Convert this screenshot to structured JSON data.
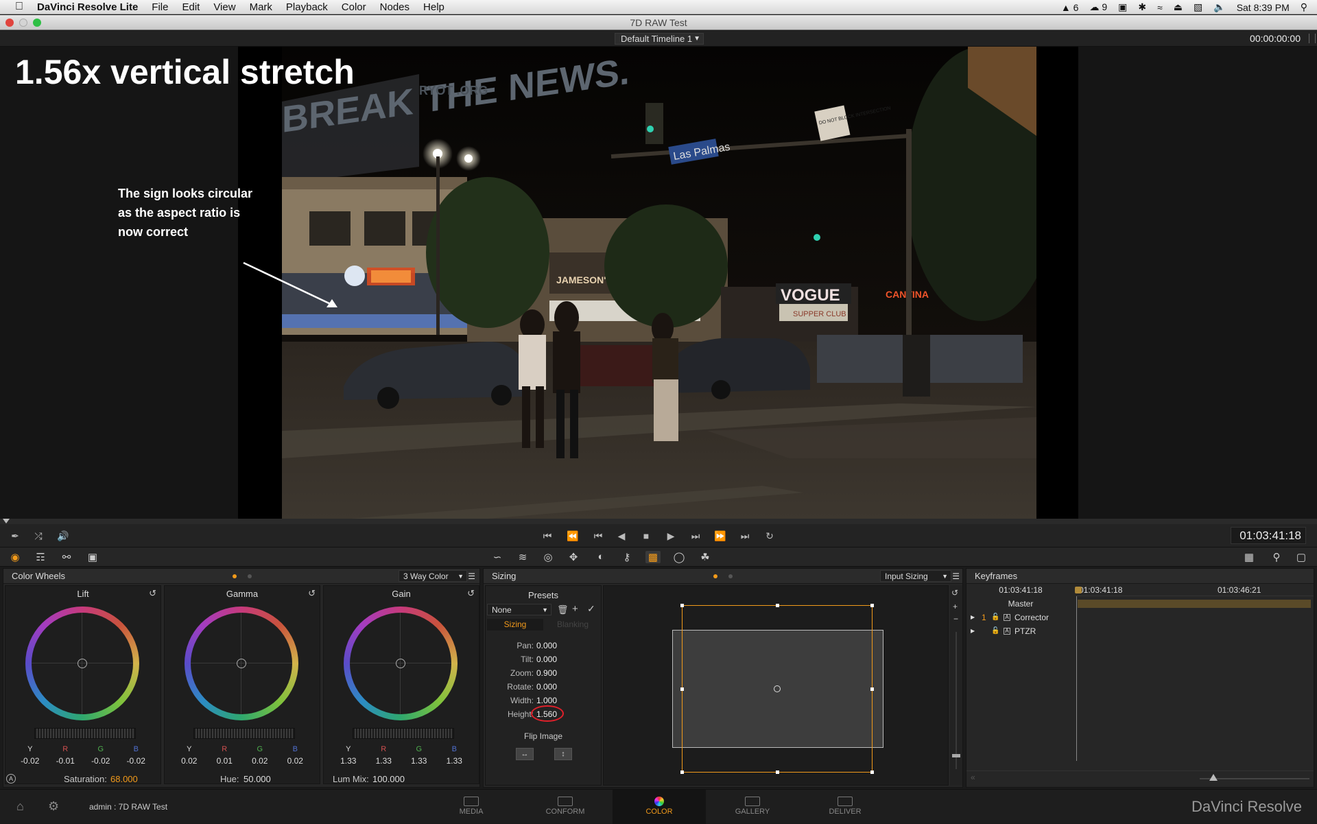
{
  "menubar": {
    "app_name": "DaVinci Resolve Lite",
    "items": [
      "File",
      "Edit",
      "View",
      "Mark",
      "Playback",
      "Color",
      "Nodes",
      "Help"
    ],
    "status": {
      "adobe": "6",
      "cc": "9",
      "clock": "Sat 8:39 PM"
    }
  },
  "window": {
    "title": "7D RAW Test"
  },
  "viewer": {
    "timeline_select": "Default Timeline 1",
    "timecode_top": "00:00:00:00",
    "overlay_title": "1.56x vertical stretch",
    "annotation": [
      "The sign looks circular",
      "as the aspect ratio is",
      "now correct"
    ],
    "signs": {
      "billboard": "BREAK THE NEWS.",
      "ryot": "RYOT .ORG",
      "street": "Las Palmas",
      "donotblock": "DO NOT BLOCK INTERSECTION",
      "pub": "JAMESON'S IRISH PUB",
      "vogue": "VOGUE",
      "club": "SUPPER CLUB",
      "cantina": "CANTINA"
    }
  },
  "transport": {
    "timecode": "01:03:41:18"
  },
  "color_wheels": {
    "title": "Color Wheels",
    "mode": "3 Way Color",
    "wheels": [
      {
        "name": "Lift",
        "labels": [
          "Y",
          "R",
          "G",
          "B"
        ],
        "values": [
          "-0.02",
          "-0.01",
          "-0.02",
          "-0.02"
        ]
      },
      {
        "name": "Gamma",
        "labels": [
          "Y",
          "R",
          "G",
          "B"
        ],
        "values": [
          "0.02",
          "0.01",
          "0.02",
          "0.02"
        ]
      },
      {
        "name": "Gain",
        "labels": [
          "Y",
          "R",
          "G",
          "B"
        ],
        "values": [
          "1.33",
          "1.33",
          "1.33",
          "1.33"
        ]
      }
    ],
    "footer": {
      "saturation_label": "Saturation:",
      "saturation": "68.000",
      "hue_label": "Hue:",
      "hue": "50.000",
      "lummix_label": "Lum Mix:",
      "lummix": "100.000"
    }
  },
  "sizing": {
    "title": "Sizing",
    "mode": "Input Sizing",
    "presets_label": "Presets",
    "preset_value": "None",
    "tabs": [
      "Sizing",
      "Blanking"
    ],
    "params": [
      {
        "label": "Pan:",
        "value": "0.000"
      },
      {
        "label": "Tilt:",
        "value": "0.000"
      },
      {
        "label": "Zoom:",
        "value": "0.900"
      },
      {
        "label": "Rotate:",
        "value": "0.000"
      },
      {
        "label": "Width:",
        "value": "1.000"
      },
      {
        "label": "Height:",
        "value": "1.560"
      }
    ],
    "flip_label": "Flip Image"
  },
  "keyframes": {
    "title": "Keyframes",
    "tc_left": "01:03:41:18",
    "tc_ruler_1": "01:03:41:18",
    "tc_ruler_2": "01:03:46:21",
    "tracks": [
      {
        "name": "Master"
      },
      {
        "num": "1",
        "name": "Corrector"
      },
      {
        "name": "PTZR"
      }
    ]
  },
  "bottom": {
    "project": "admin : 7D RAW Test",
    "tabs": [
      "MEDIA",
      "CONFORM",
      "COLOR",
      "GALLERY",
      "DELIVER"
    ],
    "brand": "DaVinci Resolve"
  },
  "colors": {
    "accent": "#f29a1a",
    "highlight_circle": "#e0202a"
  }
}
